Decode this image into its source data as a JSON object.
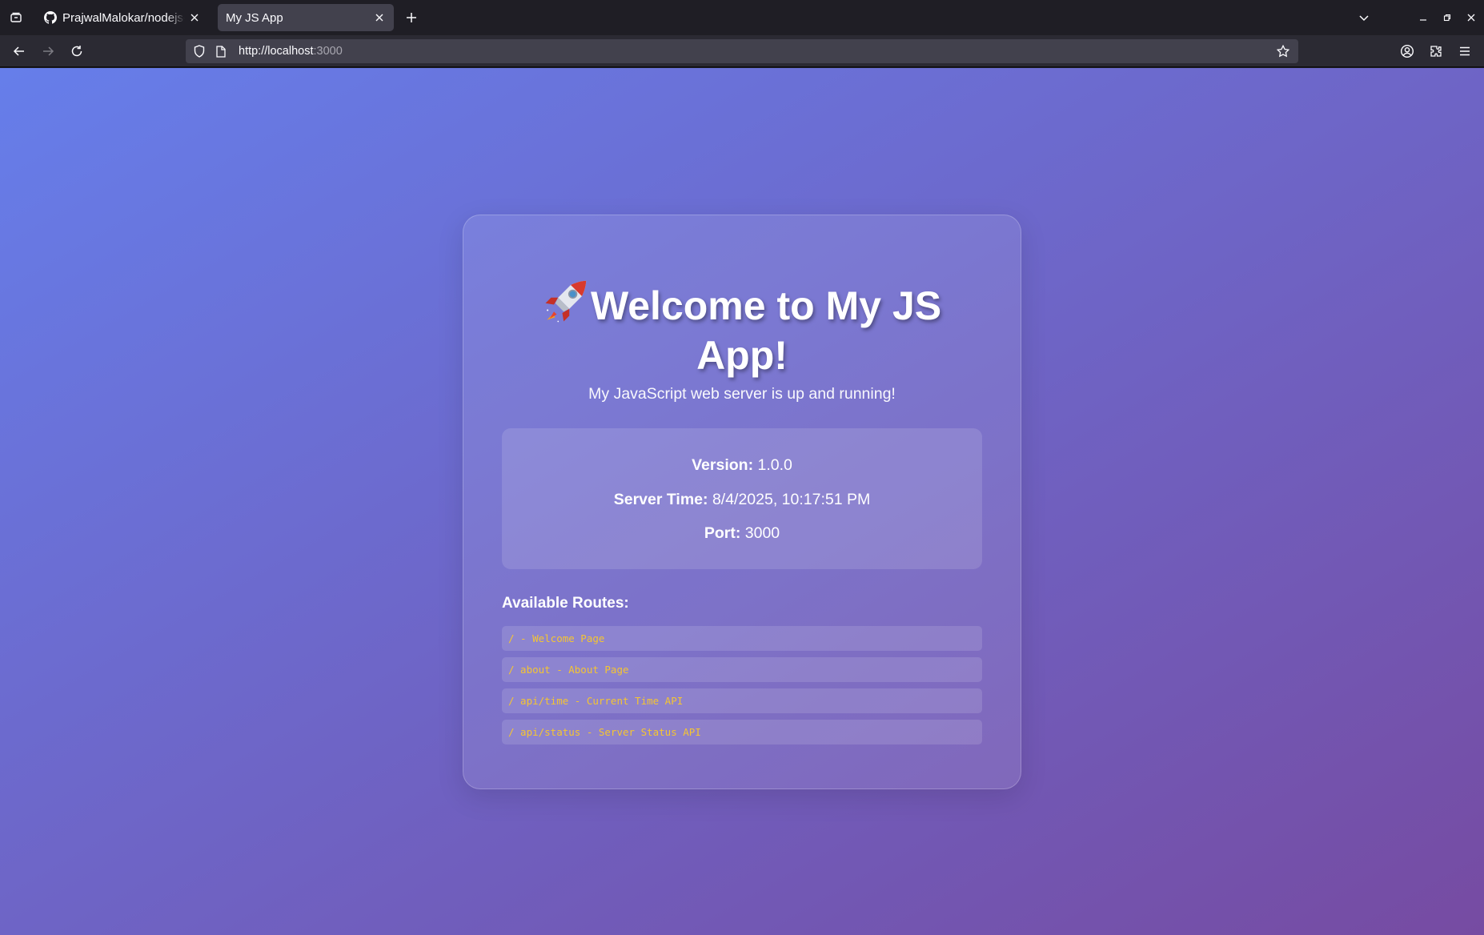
{
  "browser": {
    "tabs": [
      {
        "title": "PrajwalMalokar/nodejs-demo",
        "active": false,
        "favicon": "github-icon"
      },
      {
        "title": "My JS App",
        "active": true,
        "favicon": ""
      }
    ],
    "url": {
      "host": "http://localhost",
      "port": ":3000"
    }
  },
  "page": {
    "title_emoji": "🚀",
    "title": "Welcome to My JS App!",
    "subtitle": "My JavaScript web server is up and running!",
    "info": {
      "version_label": "Version:",
      "version_value": "1.0.0",
      "time_label": "Server Time:",
      "time_value": "8/4/2025, 10:17:51 PM",
      "port_label": "Port:",
      "port_value": "3000"
    },
    "routes_heading": "Available Routes:",
    "routes": [
      "/ - Welcome Page",
      "/ about - About Page",
      "/ api/time - Current Time API",
      "/ api/status - Server Status API"
    ]
  },
  "colors": {
    "gradient_start": "#667eea",
    "gradient_end": "#764ba2",
    "route_text": "#f5c531"
  }
}
